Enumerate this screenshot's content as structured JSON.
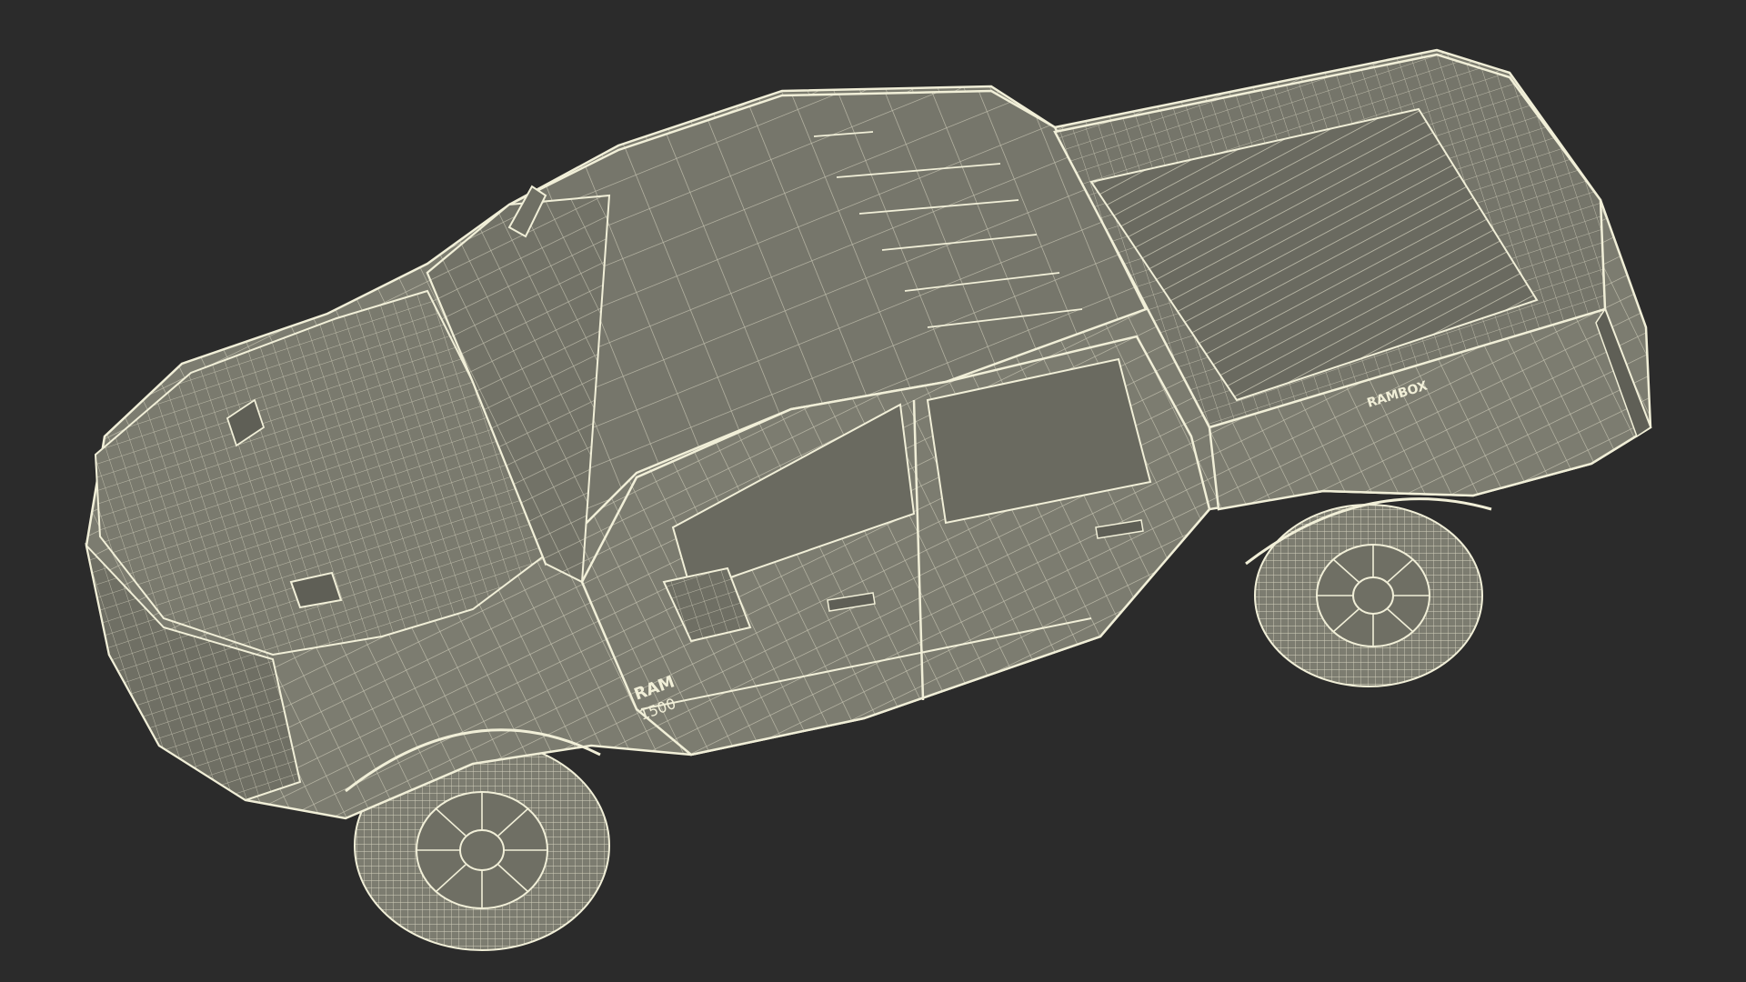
{
  "scene": {
    "subject": "pickup-truck-wireframe",
    "background_color": "#2b2b2b",
    "surface_color": "#7c7c70",
    "surface_shadow_color": "#5f5f56",
    "wire_color": "#f1efd8",
    "badge_text": "RAM",
    "model_text": "1500",
    "bed_text": "RAMBOX"
  }
}
